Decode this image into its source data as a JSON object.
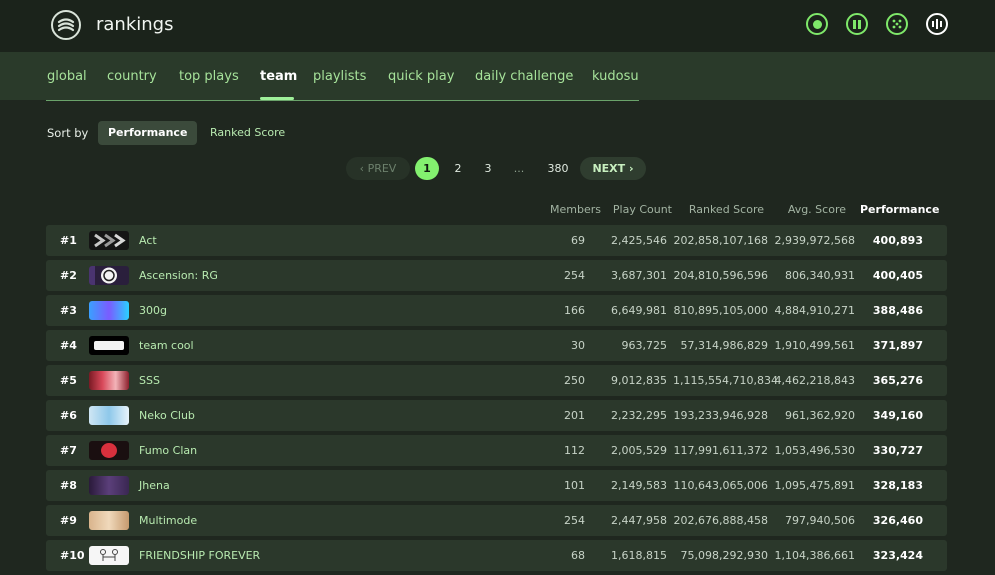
{
  "header": {
    "title": "rankings",
    "icons": [
      {
        "name": "live-icon",
        "color": "#7fe86a"
      },
      {
        "name": "pause-icon",
        "color": "#7fe86a"
      },
      {
        "name": "dice-icon",
        "color": "#7fe86a"
      },
      {
        "name": "audio-icon",
        "color": "#ffffff"
      }
    ]
  },
  "tabs": [
    "global",
    "country",
    "top plays",
    "team",
    "playlists",
    "quick play",
    "daily challenge",
    "kudosu"
  ],
  "active_tab": "team",
  "sort": {
    "label": "Sort by",
    "options": [
      "Performance",
      "Ranked Score"
    ],
    "selected": "Performance"
  },
  "pagination": {
    "prev": "PREV",
    "next": "NEXT",
    "pages": [
      "1",
      "2",
      "3",
      "...",
      "380"
    ],
    "current": "1"
  },
  "columns": [
    "Members",
    "Play Count",
    "Ranked Score",
    "Avg. Score",
    "Performance"
  ],
  "rows": [
    {
      "rank": "#1",
      "name": "Act",
      "members": "69",
      "play_count": "2,425,546",
      "ranked_score": "202,858,107,168",
      "avg_score": "2,939,972,568",
      "performance": "400,893"
    },
    {
      "rank": "#2",
      "name": "Ascension: RG",
      "members": "254",
      "play_count": "3,687,301",
      "ranked_score": "204,810,596,596",
      "avg_score": "806,340,931",
      "performance": "400,405"
    },
    {
      "rank": "#3",
      "name": "300g",
      "members": "166",
      "play_count": "6,649,981",
      "ranked_score": "810,895,105,000",
      "avg_score": "4,884,910,271",
      "performance": "388,486"
    },
    {
      "rank": "#4",
      "name": "team cool",
      "members": "30",
      "play_count": "963,725",
      "ranked_score": "57,314,986,829",
      "avg_score": "1,910,499,561",
      "performance": "371,897"
    },
    {
      "rank": "#5",
      "name": "SSS",
      "members": "250",
      "play_count": "9,012,835",
      "ranked_score": "1,115,554,710,834",
      "avg_score": "4,462,218,843",
      "performance": "365,276"
    },
    {
      "rank": "#6",
      "name": "Neko Club",
      "members": "201",
      "play_count": "2,232,295",
      "ranked_score": "193,233,946,928",
      "avg_score": "961,362,920",
      "performance": "349,160"
    },
    {
      "rank": "#7",
      "name": "Fumo Clan",
      "members": "112",
      "play_count": "2,005,529",
      "ranked_score": "117,991,611,372",
      "avg_score": "1,053,496,530",
      "performance": "330,727"
    },
    {
      "rank": "#8",
      "name": "Jhena",
      "members": "101",
      "play_count": "2,149,583",
      "ranked_score": "110,643,065,006",
      "avg_score": "1,095,475,891",
      "performance": "328,183"
    },
    {
      "rank": "#9",
      "name": "Multimode",
      "members": "254",
      "play_count": "2,447,958",
      "ranked_score": "202,676,888,458",
      "avg_score": "797,940,506",
      "performance": "326,460"
    },
    {
      "rank": "#10",
      "name": "FRIENDSHIP FOREVER",
      "members": "68",
      "play_count": "1,618,815",
      "ranked_score": "75,098,292,930",
      "avg_score": "1,104,386,661",
      "performance": "323,424"
    }
  ]
}
